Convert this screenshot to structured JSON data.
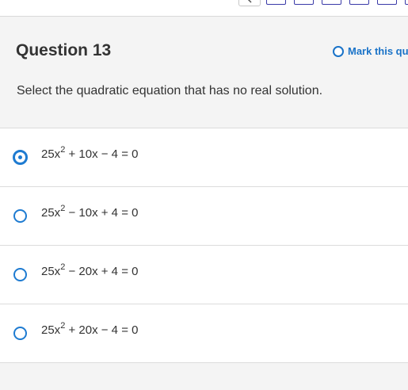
{
  "question": {
    "title": "Question 13",
    "mark_label": "Mark this qu",
    "prompt": "Select the quadratic equation that has no real solution."
  },
  "options": [
    {
      "coef": "25x",
      "exp": "2",
      "rest": " + 10x − 4 = 0",
      "selected": true
    },
    {
      "coef": "25x",
      "exp": "2",
      "rest": " − 10x + 4 = 0",
      "selected": false
    },
    {
      "coef": "25x",
      "exp": "2",
      "rest": " − 20x + 4 = 0",
      "selected": false
    },
    {
      "coef": "25x",
      "exp": "2",
      "rest": " + 20x − 4 = 0",
      "selected": false
    }
  ],
  "colors": {
    "accent": "#1e7bd1",
    "nav_border": "#3a3aa8",
    "panel_bg": "#f4f4f4"
  },
  "icons": {
    "nav_arrow": "chevron-left-icon",
    "mark": "circle-outline-icon"
  }
}
